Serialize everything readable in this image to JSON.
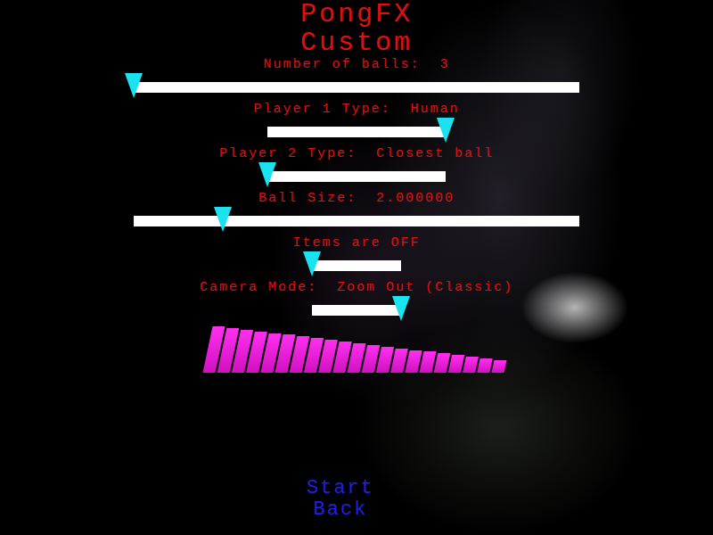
{
  "title": [
    "PongFX",
    "Custom"
  ],
  "settings": [
    {
      "label": "Number of balls:  3",
      "kind": "wide",
      "level": 0
    },
    {
      "label": "Player 1 Type:  Human",
      "kind": "medium",
      "level": 1
    },
    {
      "label": "Player 2 Type:  Closest ball",
      "kind": "medium",
      "level": 0
    },
    {
      "label": "Ball Size:  2.000000",
      "kind": "wide",
      "level": 0.2
    },
    {
      "label": "Items are OFF",
      "kind": "short",
      "level": 0
    },
    {
      "label": "Camera Mode:  Zoom Out (Classic)",
      "kind": "short",
      "level": 1
    }
  ],
  "menu": [
    {
      "label": "Start"
    },
    {
      "label": "Back"
    }
  ]
}
